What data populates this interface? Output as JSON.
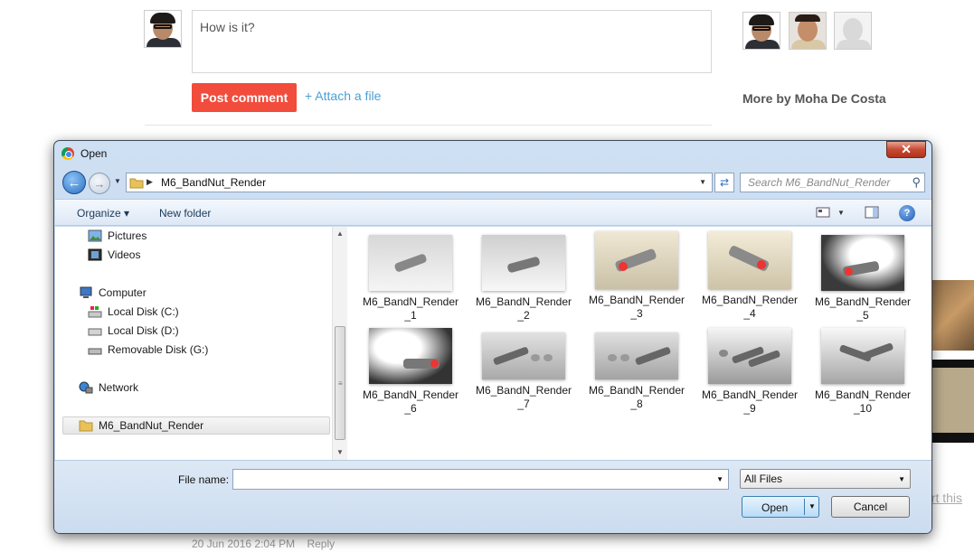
{
  "background": {
    "comment_input_value": "How is it?",
    "post_comment_label": "Post comment",
    "attach_file_label": "+ Attach a file",
    "more_by_label": "More by Moha De Costa",
    "timestamp": "20 Jun 2016 2:04 PM",
    "reply_label": "Reply",
    "report_label": "ort this"
  },
  "dialog": {
    "title": "Open",
    "close_glyph": "✕",
    "address_path": "M6_BandNut_Render",
    "search_placeholder": "Search M6_BandNut_Render",
    "toolbar": {
      "organize_label": "Organize ▾",
      "new_folder_label": "New folder"
    },
    "nav_items": [
      {
        "label": "Pictures",
        "icon": "pictures-icon"
      },
      {
        "label": "Videos",
        "icon": "videos-icon"
      },
      {
        "label": "Computer",
        "icon": "computer-icon"
      },
      {
        "label": "Local Disk (C:)",
        "icon": "local-disk-icon"
      },
      {
        "label": "Local Disk (D:)",
        "icon": "drive-icon"
      },
      {
        "label": "Removable Disk (G:)",
        "icon": "removable-disk-icon"
      },
      {
        "label": "Network",
        "icon": "network-icon"
      },
      {
        "label": "M6_BandNut_Render",
        "icon": "folder-icon"
      }
    ],
    "files": [
      {
        "label": "M6_BandN_Render_1"
      },
      {
        "label": "M6_BandN_Render_2"
      },
      {
        "label": "M6_BandN_Render_3"
      },
      {
        "label": "M6_BandN_Render_4"
      },
      {
        "label": "M6_BandN_Render_5"
      },
      {
        "label": "M6_BandN_Render_6"
      },
      {
        "label": "M6_BandN_Render_7"
      },
      {
        "label": "M6_BandN_Render_8"
      },
      {
        "label": "M6_BandN_Render_9"
      },
      {
        "label": "M6_BandN_Render_10"
      }
    ],
    "file_name_label": "File name:",
    "file_name_value": "",
    "file_type_value": "All Files",
    "open_label": "Open",
    "cancel_label": "Cancel"
  }
}
